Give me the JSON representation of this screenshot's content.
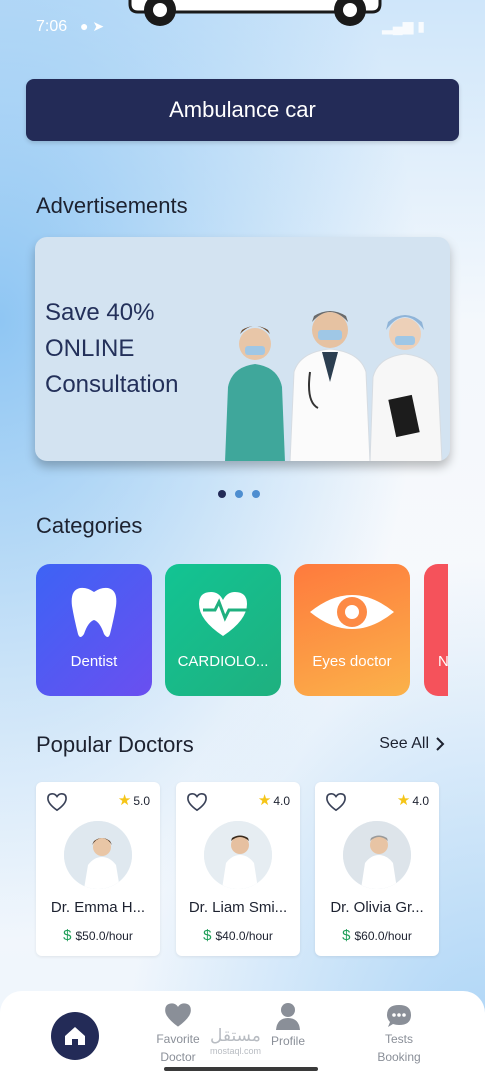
{
  "status_bar": {
    "time": "7:06"
  },
  "header": {
    "ambulance_button": "Ambulance car"
  },
  "advertisements": {
    "title": "Advertisements",
    "banner_lines": [
      "Save 40%",
      "ONLINE",
      "Consultation"
    ],
    "dots": 3,
    "active_dot": 0
  },
  "categories": {
    "title": "Categories",
    "items": [
      {
        "label": "Dentist",
        "icon": "tooth-icon",
        "color": "#4f55f0"
      },
      {
        "label": "CARDIOLO...",
        "icon": "heart-pulse-icon",
        "color": "#18c48a"
      },
      {
        "label": "Eyes doctor",
        "icon": "eye-icon",
        "color": "#fd8a45"
      },
      {
        "label": "N",
        "icon": "category-icon",
        "color": "#f5525b"
      }
    ]
  },
  "popular_doctors": {
    "title": "Popular Doctors",
    "see_all": "See All",
    "doctors": [
      {
        "name": "Dr. Emma H...",
        "rating": "5.0",
        "price": "$50.0/hour"
      },
      {
        "name": "Dr. Liam Smi...",
        "rating": "4.0",
        "price": "$40.0/hour"
      },
      {
        "name": "Dr. Olivia Gr...",
        "rating": "4.0",
        "price": "$60.0/hour"
      }
    ]
  },
  "bottom_nav": {
    "items": [
      {
        "label": "",
        "icon": "home-icon"
      },
      {
        "label": "Favorite Doctor",
        "line1": "Favorite",
        "line2": "Doctor",
        "icon": "heart-icon"
      },
      {
        "label": "Profile",
        "icon": "person-icon"
      },
      {
        "label": "Tests Booking",
        "line1": "Tests",
        "line2": "Booking",
        "icon": "chat-icon"
      }
    ]
  },
  "watermark": {
    "text": "مستقل",
    "sub": "mostaql.com"
  },
  "colors": {
    "primary": "#232b57",
    "accent_blue": "#4e8ed0",
    "star": "#f5c518",
    "price_green": "#1e9e58"
  }
}
